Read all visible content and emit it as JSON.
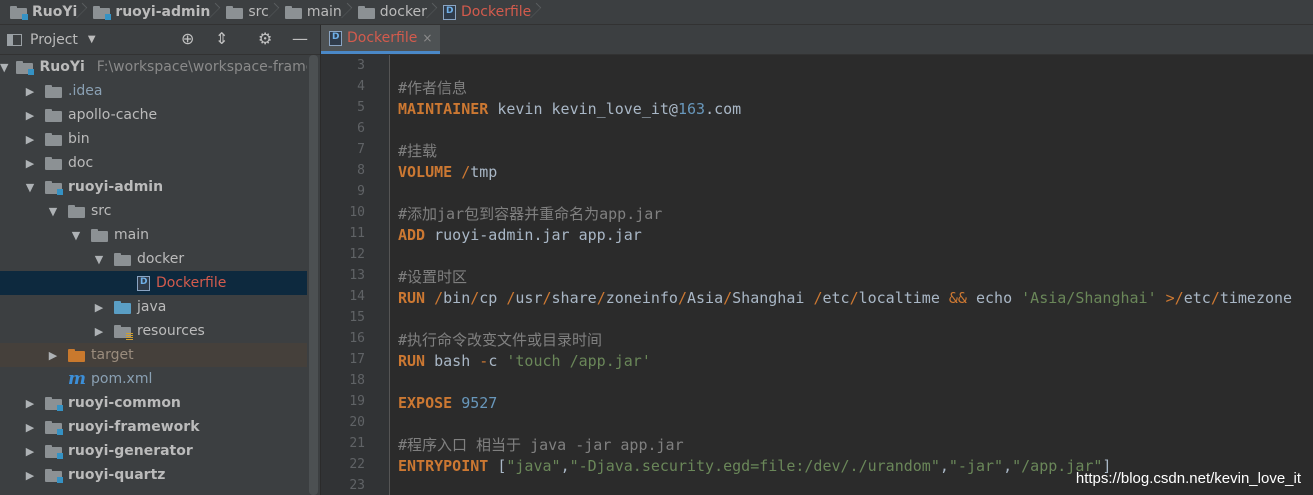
{
  "breadcrumbs": [
    {
      "label": "RuoYi",
      "icon": "module-folder-icon",
      "bold": true
    },
    {
      "label": "ruoyi-admin",
      "icon": "module-folder-icon",
      "bold": true
    },
    {
      "label": "src",
      "icon": "folder-icon"
    },
    {
      "label": "main",
      "icon": "folder-icon"
    },
    {
      "label": "docker",
      "icon": "folder-icon"
    },
    {
      "label": "Dockerfile",
      "icon": "dockerfile-icon",
      "file": true
    }
  ],
  "project_panel": {
    "title": "Project",
    "tree": [
      {
        "depth": 0,
        "expanded": true,
        "name": "RuoYi",
        "path": "F:\\workspace\\workspace-frame",
        "icon": "module",
        "bold": true
      },
      {
        "depth": 1,
        "expanded": false,
        "name": ".idea",
        "icon": "folder",
        "style": "dim"
      },
      {
        "depth": 1,
        "expanded": false,
        "name": "apollo-cache",
        "icon": "folder"
      },
      {
        "depth": 1,
        "expanded": false,
        "name": "bin",
        "icon": "folder"
      },
      {
        "depth": 1,
        "expanded": false,
        "name": "doc",
        "icon": "folder"
      },
      {
        "depth": 1,
        "expanded": true,
        "name": "ruoyi-admin",
        "icon": "module",
        "bold": true
      },
      {
        "depth": 2,
        "expanded": true,
        "name": "src",
        "icon": "folder"
      },
      {
        "depth": 3,
        "expanded": true,
        "name": "main",
        "icon": "folder"
      },
      {
        "depth": 4,
        "expanded": true,
        "name": "docker",
        "icon": "folder"
      },
      {
        "depth": 5,
        "leaf": true,
        "name": "Dockerfile",
        "icon": "dockerfile",
        "style": "red",
        "selected": true
      },
      {
        "depth": 4,
        "expanded": false,
        "name": "java",
        "icon": "source"
      },
      {
        "depth": 4,
        "expanded": false,
        "name": "resources",
        "icon": "resources"
      },
      {
        "depth": 2,
        "expanded": false,
        "name": "target",
        "icon": "excluded",
        "style": "target",
        "excluded": true
      },
      {
        "depth": 2,
        "leaf": true,
        "name": "pom.xml",
        "icon": "maven",
        "style": "dim"
      },
      {
        "depth": 1,
        "expanded": false,
        "name": "ruoyi-common",
        "icon": "module",
        "bold": true
      },
      {
        "depth": 1,
        "expanded": false,
        "name": "ruoyi-framework",
        "icon": "module",
        "bold": true
      },
      {
        "depth": 1,
        "expanded": false,
        "name": "ruoyi-generator",
        "icon": "module",
        "bold": true
      },
      {
        "depth": 1,
        "expanded": false,
        "name": "ruoyi-quartz",
        "icon": "module",
        "bold": true
      }
    ]
  },
  "editor": {
    "tab": {
      "label": "Dockerfile",
      "close": "×"
    },
    "lines": [
      {
        "n": "3",
        "tokens": []
      },
      {
        "n": "4",
        "tokens": [
          {
            "t": "#作者信息",
            "c": "com"
          }
        ]
      },
      {
        "n": "5",
        "tokens": [
          {
            "t": "MAINTAINER",
            "c": "kw"
          },
          {
            "t": " kevin kevin_love_it@"
          },
          {
            "t": "163",
            "c": "num"
          },
          {
            "t": ".com"
          }
        ]
      },
      {
        "n": "6",
        "tokens": []
      },
      {
        "n": "7",
        "tokens": [
          {
            "t": "#挂载",
            "c": "com"
          }
        ]
      },
      {
        "n": "8",
        "tokens": [
          {
            "t": "VOLUME",
            "c": "kw"
          },
          {
            "t": " "
          },
          {
            "t": "/",
            "c": "op"
          },
          {
            "t": "tmp"
          }
        ]
      },
      {
        "n": "9",
        "tokens": []
      },
      {
        "n": "10",
        "tokens": [
          {
            "t": "#添加jar包到容器并重命名为app.jar",
            "c": "com"
          }
        ]
      },
      {
        "n": "11",
        "tokens": [
          {
            "t": "ADD",
            "c": "kw"
          },
          {
            "t": " ruoyi-admin.jar app.jar"
          }
        ]
      },
      {
        "n": "12",
        "tokens": []
      },
      {
        "n": "13",
        "tokens": [
          {
            "t": "#设置时区",
            "c": "com"
          }
        ]
      },
      {
        "n": "14",
        "tokens": [
          {
            "t": "RUN",
            "c": "kw"
          },
          {
            "t": " "
          },
          {
            "t": "/",
            "c": "op"
          },
          {
            "t": "bin"
          },
          {
            "t": "/",
            "c": "op"
          },
          {
            "t": "cp "
          },
          {
            "t": "/",
            "c": "op"
          },
          {
            "t": "usr"
          },
          {
            "t": "/",
            "c": "op"
          },
          {
            "t": "share"
          },
          {
            "t": "/",
            "c": "op"
          },
          {
            "t": "zoneinfo"
          },
          {
            "t": "/",
            "c": "op"
          },
          {
            "t": "Asia"
          },
          {
            "t": "/",
            "c": "op"
          },
          {
            "t": "Shanghai "
          },
          {
            "t": "/",
            "c": "op"
          },
          {
            "t": "etc"
          },
          {
            "t": "/",
            "c": "op"
          },
          {
            "t": "localtime "
          },
          {
            "t": "&&",
            "c": "op"
          },
          {
            "t": " echo "
          },
          {
            "t": "'Asia/Shanghai'",
            "c": "str"
          },
          {
            "t": " "
          },
          {
            "t": ">/",
            "c": "op"
          },
          {
            "t": "etc"
          },
          {
            "t": "/",
            "c": "op"
          },
          {
            "t": "timezone"
          }
        ]
      },
      {
        "n": "15",
        "tokens": []
      },
      {
        "n": "16",
        "tokens": [
          {
            "t": "#执行命令改变文件或目录时间",
            "c": "com"
          }
        ]
      },
      {
        "n": "17",
        "tokens": [
          {
            "t": "RUN",
            "c": "kw"
          },
          {
            "t": " bash "
          },
          {
            "t": "-",
            "c": "op"
          },
          {
            "t": "c "
          },
          {
            "t": "'touch /app.jar'",
            "c": "str"
          }
        ]
      },
      {
        "n": "18",
        "tokens": []
      },
      {
        "n": "19",
        "tokens": [
          {
            "t": "EXPOSE",
            "c": "kw"
          },
          {
            "t": " "
          },
          {
            "t": "9527",
            "c": "num"
          }
        ]
      },
      {
        "n": "20",
        "tokens": []
      },
      {
        "n": "21",
        "tokens": [
          {
            "t": "#程序入口 相当于 java -jar app.jar",
            "c": "com"
          }
        ]
      },
      {
        "n": "22",
        "tokens": [
          {
            "t": "ENTRYPOINT",
            "c": "kw"
          },
          {
            "t": " ["
          },
          {
            "t": "\"java\"",
            "c": "str"
          },
          {
            "t": ","
          },
          {
            "t": "\"-Djava.security.egd=file:/dev/./urandom\"",
            "c": "str"
          },
          {
            "t": ","
          },
          {
            "t": "\"-jar\"",
            "c": "str"
          },
          {
            "t": ","
          },
          {
            "t": "\"/app.jar\"",
            "c": "str"
          },
          {
            "t": "]"
          }
        ]
      },
      {
        "n": "23",
        "tokens": []
      }
    ]
  },
  "watermark": "https://blog.csdn.net/kevin_love_it",
  "colors": {
    "keyword": "#cc7832",
    "string": "#6a8759",
    "comment": "#808080",
    "number": "#6897bb",
    "selection": "#0d293e"
  }
}
